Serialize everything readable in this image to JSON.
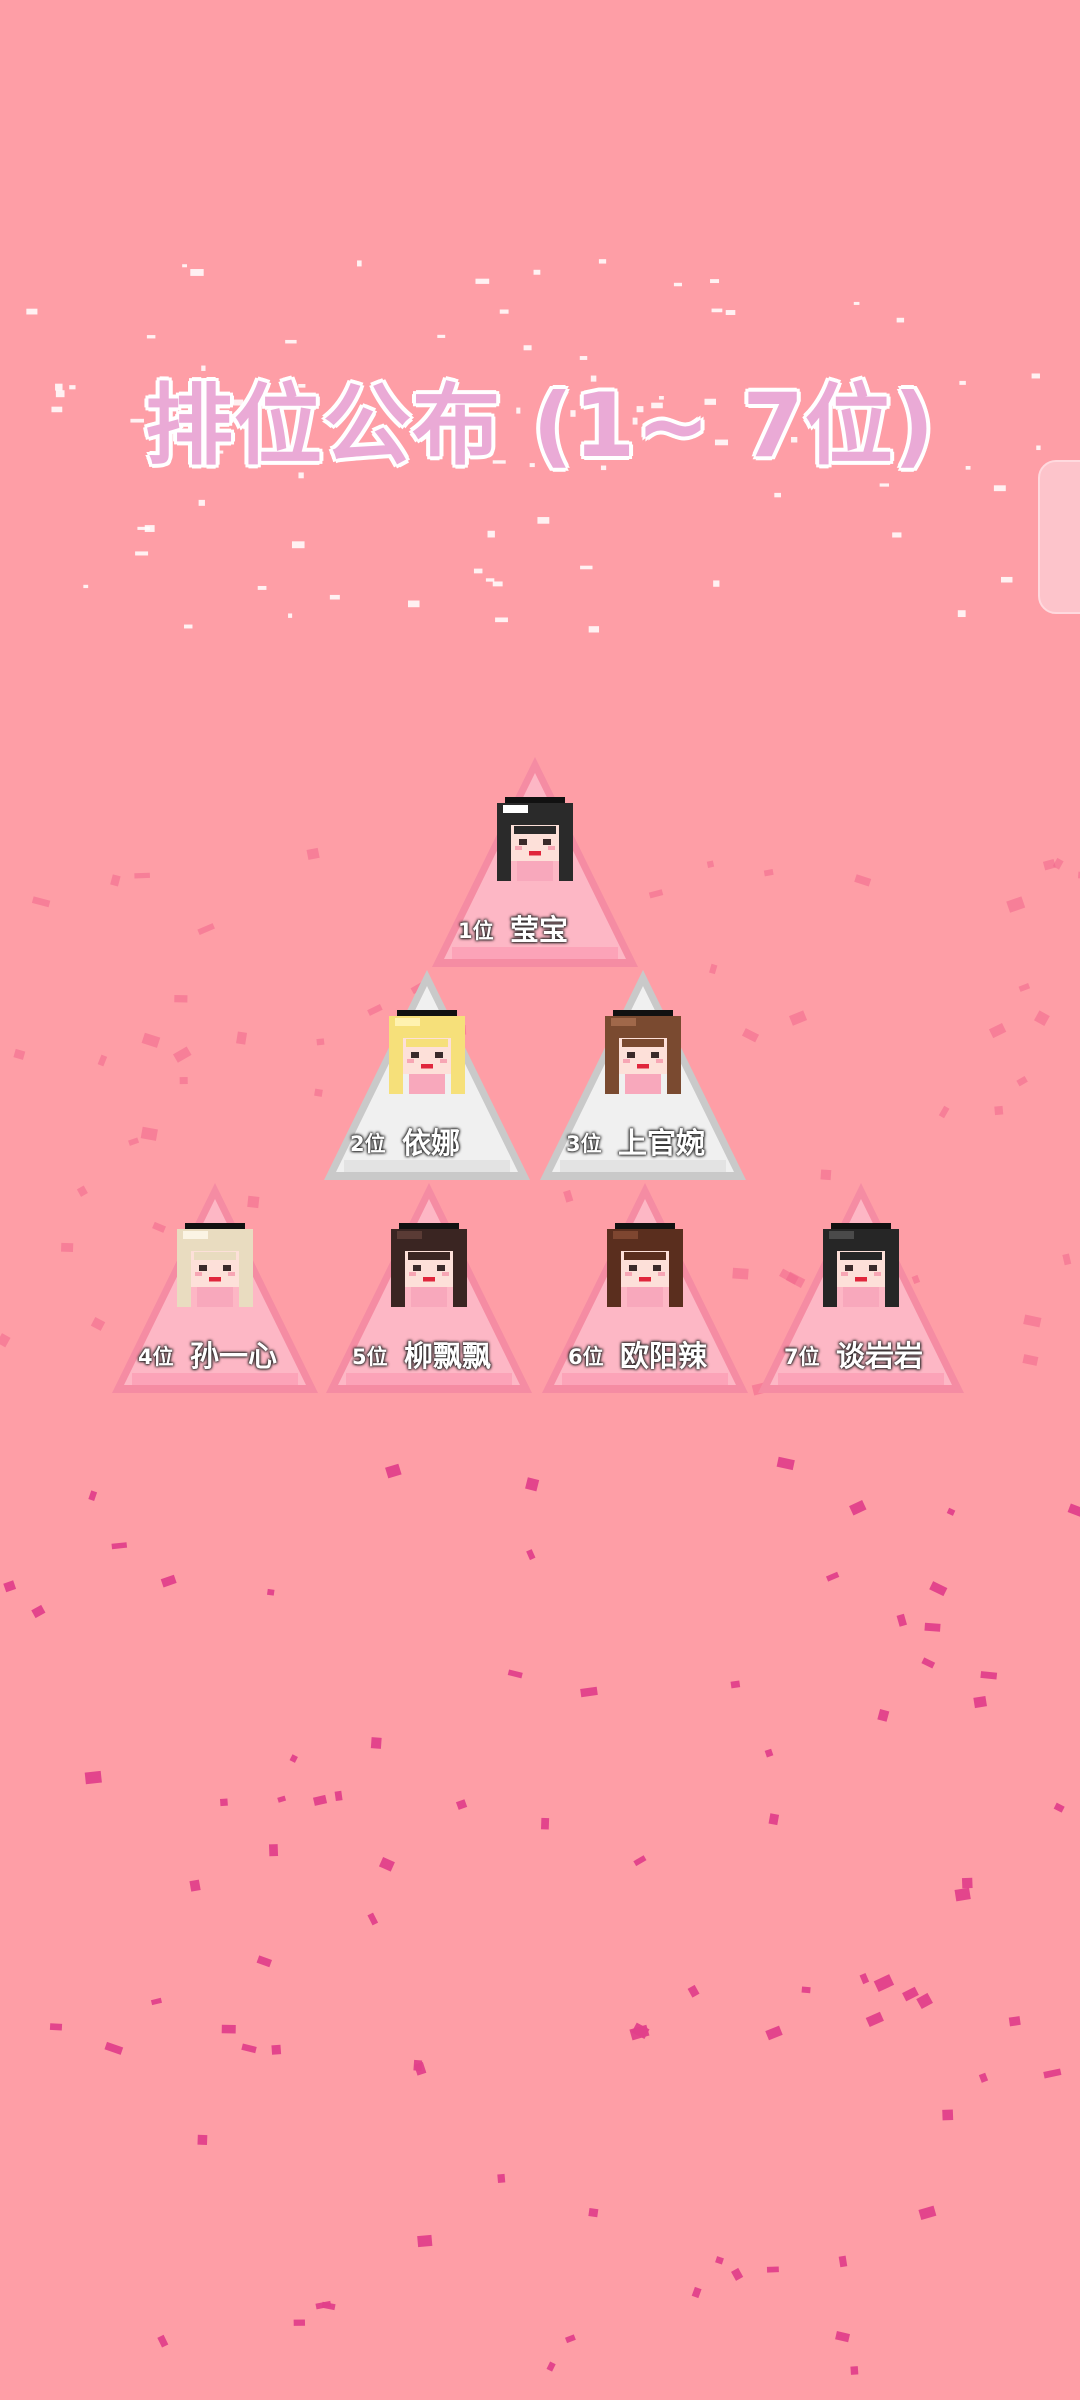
{
  "page": {
    "title": "排位公布 (1~ 7位)"
  },
  "colors": {
    "background": "#fe9ea6",
    "title_fill": "#eaaad6",
    "pink_triangle": "#fdb7c5",
    "gray_triangle": "#f0f0f0",
    "confetti": "#e2408a"
  },
  "ranking": [
    {
      "rank": "1位",
      "name": "莹宝",
      "hair": "#2a2a2a",
      "accent": "#ffffff",
      "bg": "pink"
    },
    {
      "rank": "2位",
      "name": "依娜",
      "hair": "#f6e07a",
      "accent": "#fff2b0",
      "bg": "gray"
    },
    {
      "rank": "3位",
      "name": "上官婉",
      "hair": "#7a4a30",
      "accent": "#a0684a",
      "bg": "gray"
    },
    {
      "rank": "4位",
      "name": "孙一心",
      "hair": "#e9dcc0",
      "accent": "#fbf4e4",
      "bg": "pink"
    },
    {
      "rank": "5位",
      "name": "柳飘飘",
      "hair": "#3a2522",
      "accent": "#5a3b35",
      "bg": "pink"
    },
    {
      "rank": "6位",
      "name": "欧阳辣",
      "hair": "#5a2e1e",
      "accent": "#7e4630",
      "bg": "pink"
    },
    {
      "rank": "7位",
      "name": "谈岩岩",
      "hair": "#262626",
      "accent": "#4a4a4a",
      "bg": "pink"
    }
  ]
}
